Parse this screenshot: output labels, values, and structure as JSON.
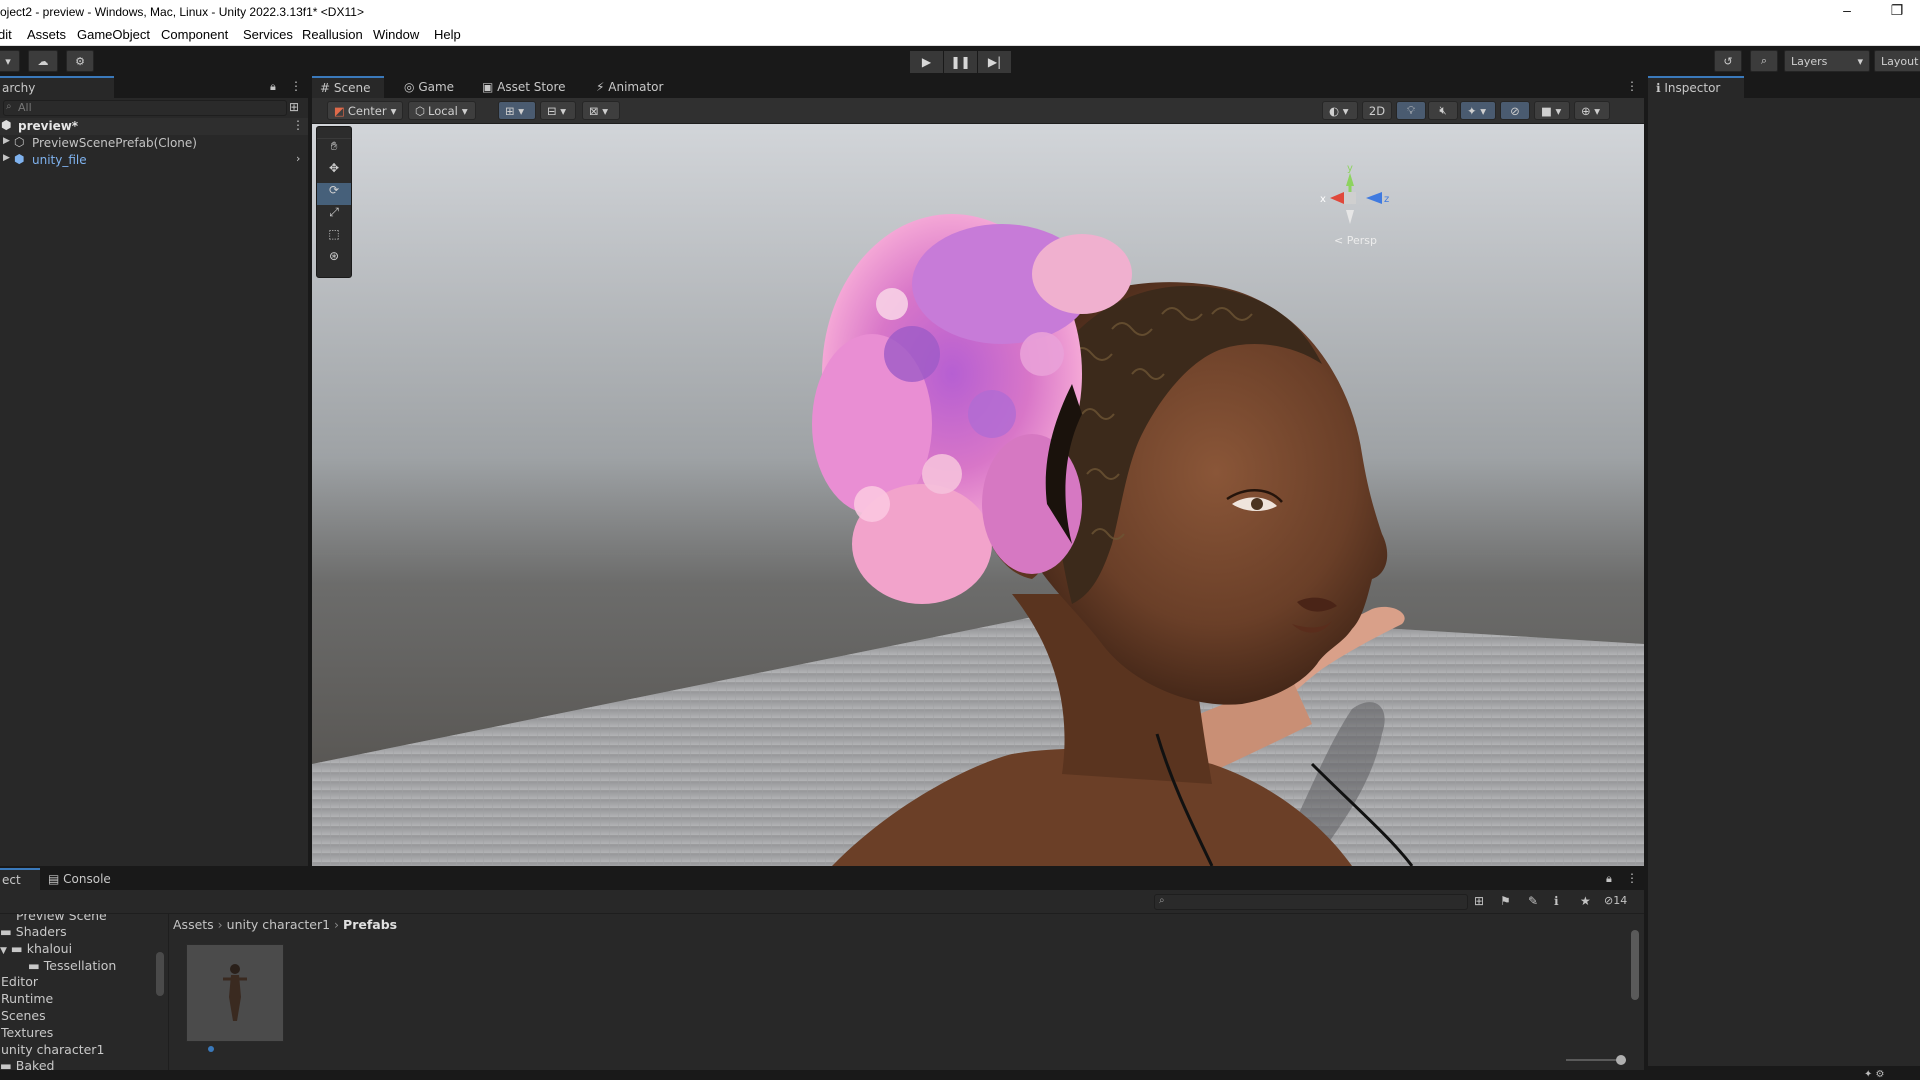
{
  "window": {
    "title": "roject2 - preview - Windows, Mac, Linux - Unity 2022.3.13f1* <DX11>",
    "minimize": "–",
    "restore": "❐"
  },
  "menu": [
    "dit",
    "Assets",
    "GameObject",
    "Component",
    "Services",
    "Reallusion",
    "Window",
    "Help"
  ],
  "toolbar": {
    "layers_label": "Layers",
    "layout_label": "Layout"
  },
  "hierarchy": {
    "tab_label": "archy",
    "search_placeholder": "All",
    "scene_name": "preview*",
    "items": [
      "PreviewScenePrefab(Clone)",
      "unity_file"
    ]
  },
  "scene_tabs": [
    "Scene",
    "Game",
    "Asset Store",
    "Animator"
  ],
  "scene_toolbar": {
    "pivot": "Center",
    "space": "Local",
    "mode_2d": "2D"
  },
  "gizmo": {
    "persp": "Persp",
    "y": "y",
    "x": "x",
    "z": "z"
  },
  "inspector": {
    "tab_label": "Inspector"
  },
  "project": {
    "tab_label": "ect",
    "console_label": "Console",
    "hidden_count": "14",
    "breadcrumb": [
      "Assets",
      "unity character1",
      "Prefabs"
    ],
    "folders": [
      "Preview Scene",
      "Shaders",
      "khaloui",
      "Tessellation",
      "Editor",
      "Runtime",
      "Scenes",
      "Textures",
      "unity character1",
      "Baked"
    ]
  },
  "colors": {
    "accent": "#3a79bb",
    "link": "#7fb2ee",
    "warning": "#e2b92a"
  }
}
